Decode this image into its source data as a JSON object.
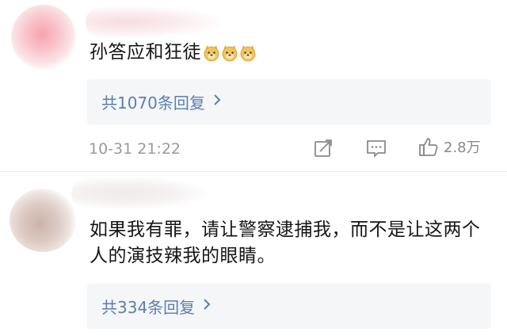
{
  "comments": [
    {
      "text": "孙答应和狂徒",
      "emoji": [
        "doge-emoji",
        "doge-emoji",
        "doge-emoji"
      ],
      "replies_label": "共1070条回复",
      "timestamp": "10-31 21:22",
      "likes": "2.8万"
    },
    {
      "text": "如果我有罪，请让警察逮捕我，而不是让这两个人的演技辣我的眼睛。",
      "replies_label": "共334条回复"
    }
  ],
  "icons": {
    "share": "share-icon",
    "comment": "comment-icon",
    "like": "thumbs-up-icon",
    "chevron": "chevron-right-icon"
  },
  "colors": {
    "link": "#5b7fae",
    "meta": "#9a9a9a",
    "reply_bg": "#f5f6f8"
  }
}
